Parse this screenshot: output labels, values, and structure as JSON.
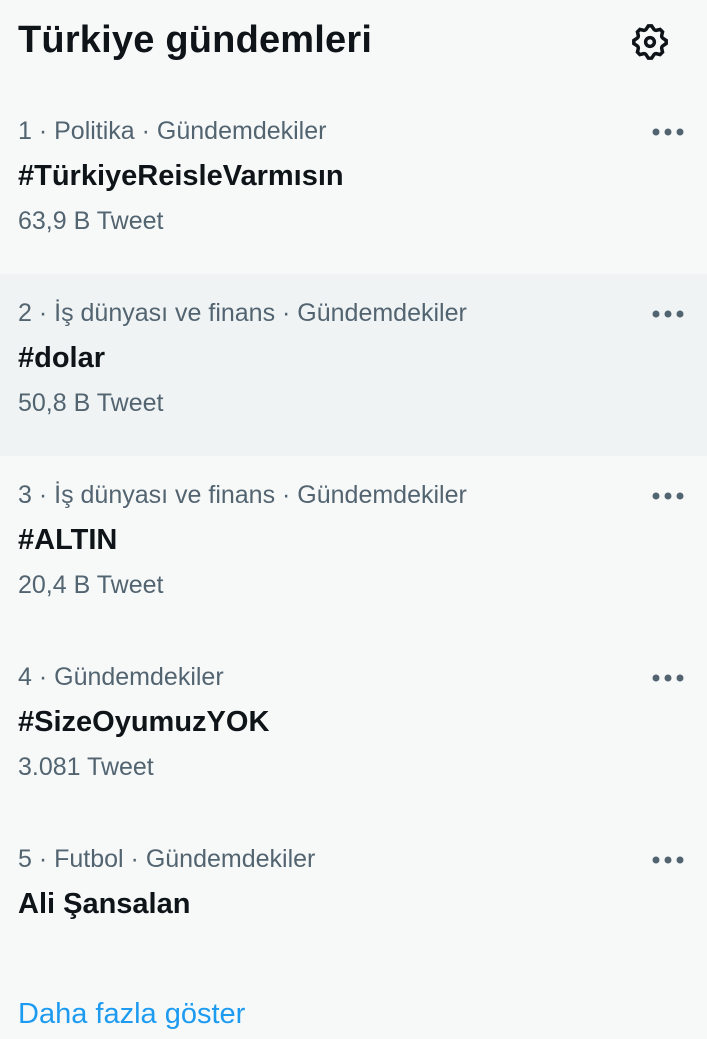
{
  "header": {
    "title": "Türkiye gündemleri",
    "settings_icon": "gear-icon"
  },
  "colors": {
    "background": "#f7f9f9",
    "highlight": "#eff3f4",
    "primary_text": "#0f1419",
    "secondary_text": "#536471",
    "link": "#1d9bf0"
  },
  "trends": [
    {
      "meta": "1 · Politika · Gündemdekiler",
      "name": "#TürkiyeReisleVarmısın",
      "count": "63,9 B Tweet",
      "more_icon": "more-horizontal-icon"
    },
    {
      "meta": "2 · İş dünyası ve finans · Gündemdekiler",
      "name": "#dolar",
      "count": "50,8 B Tweet",
      "more_icon": "more-horizontal-icon"
    },
    {
      "meta": "3 · İş dünyası ve finans · Gündemdekiler",
      "name": "#ALTIN",
      "count": "20,4 B Tweet",
      "more_icon": "more-horizontal-icon"
    },
    {
      "meta": "4 · Gündemdekiler",
      "name": "#SizeOyumuzYOK",
      "count": "3.081 Tweet",
      "more_icon": "more-horizontal-icon"
    },
    {
      "meta": "5 · Futbol · Gündemdekiler",
      "name": "Ali Şansalan",
      "count": "",
      "more_icon": "more-horizontal-icon"
    }
  ],
  "footer": {
    "show_more_label": "Daha fazla göster"
  }
}
